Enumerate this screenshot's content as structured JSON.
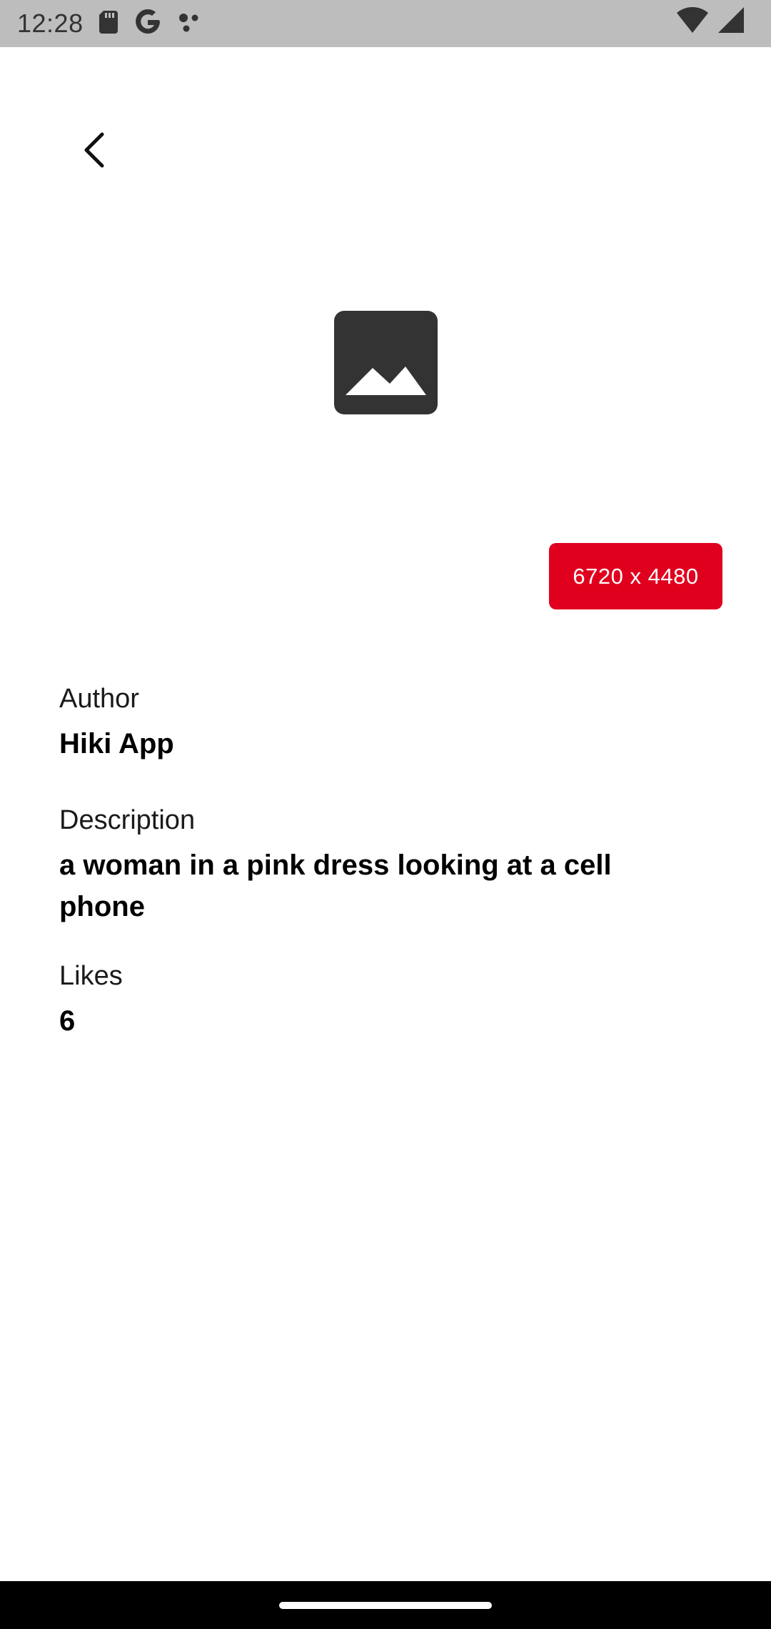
{
  "status_bar": {
    "time": "12:28",
    "icons": [
      "sd-card-icon",
      "google-icon",
      "dots-icon",
      "wifi-icon",
      "signal-icon"
    ]
  },
  "header": {
    "back_icon": "chevron-left-icon"
  },
  "image": {
    "icon": "image-placeholder-icon",
    "resolution": "6720 x 4480"
  },
  "details": {
    "author_label": "Author",
    "author_value": "Hiki App",
    "description_label": "Description",
    "description_value": "a woman in a pink dress looking at a cell phone",
    "likes_label": "Likes",
    "likes_value": "6"
  },
  "colors": {
    "accent": "#e0001e",
    "status_bar": "#bdbdbd",
    "nav_bar": "#000000",
    "placeholder": "#333333"
  }
}
